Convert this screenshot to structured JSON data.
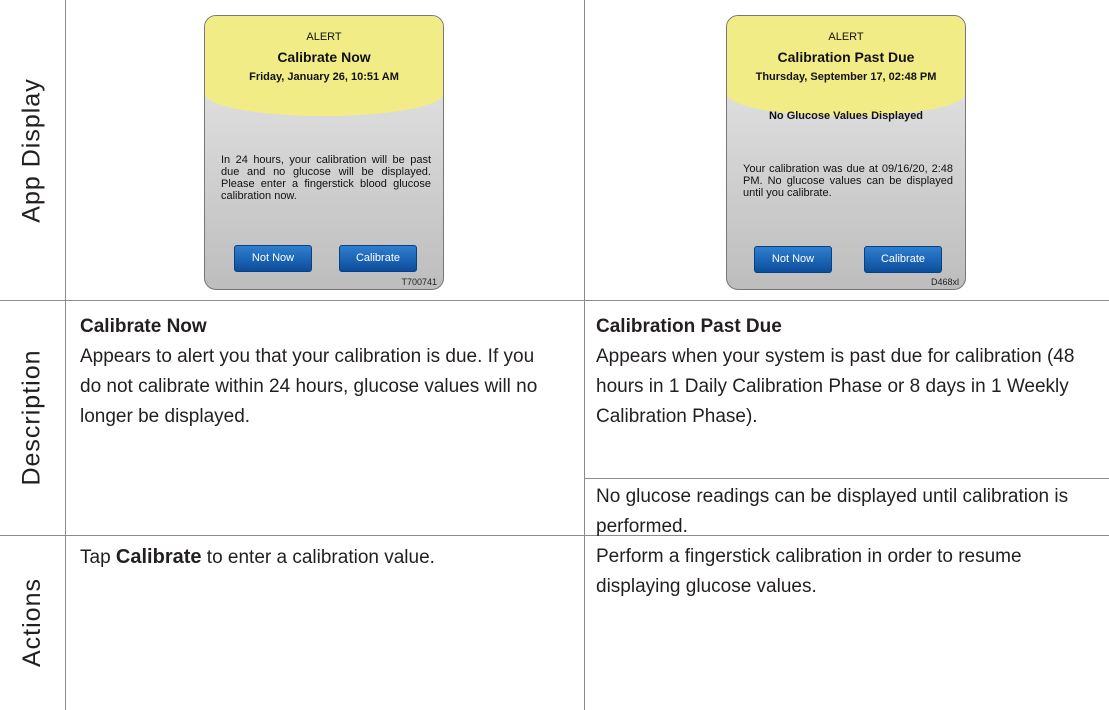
{
  "row_headers": {
    "app_display": "App Display",
    "description": "Description",
    "actions": "Actions"
  },
  "left": {
    "alert": {
      "label": "ALERT",
      "title": "Calibrate Now",
      "date": "Friday, January 26, 10:51 AM",
      "message": "In 24 hours, your calibration will be past due and no glucose will be displayed. Please enter a fingerstick blood glucose calibration now.",
      "btn_secondary": "Not Now",
      "btn_primary": "Calibrate",
      "code": "T700741"
    },
    "description": {
      "title": "Calibrate Now",
      "text": "Appears to alert you that your calibration is due. If you do not calibrate within 24 hours, glucose values will no longer be displayed."
    },
    "actions": {
      "prefix": "Tap ",
      "bold": "Calibrate",
      "suffix": " to enter a calibration value."
    }
  },
  "right": {
    "alert": {
      "label": "ALERT",
      "title": "Calibration Past Due",
      "date": "Thursday, September 17, 02:48 PM",
      "subtitle": "No Glucose Values Displayed",
      "message": "Your calibration was due at 09/16/20, 2:48 PM. No glucose values can be displayed until you calibrate.",
      "btn_secondary": "Not Now",
      "btn_primary": "Calibrate",
      "code": "D468xl"
    },
    "description": {
      "title": "Calibration Past Due",
      "text": "Appears when your system is past due for calibration (48 hours in 1 Daily Calibration Phase or 8 days in 1 Weekly Calibration Phase).",
      "text2": "No glucose readings can be displayed until calibration is performed."
    },
    "actions": {
      "text": "Perform a fingerstick calibration in order to resume displaying glucose values."
    }
  },
  "colors": {
    "alert_header": "#f1ec85",
    "button": "#1565b7",
    "rule": "#8c8c8c"
  }
}
